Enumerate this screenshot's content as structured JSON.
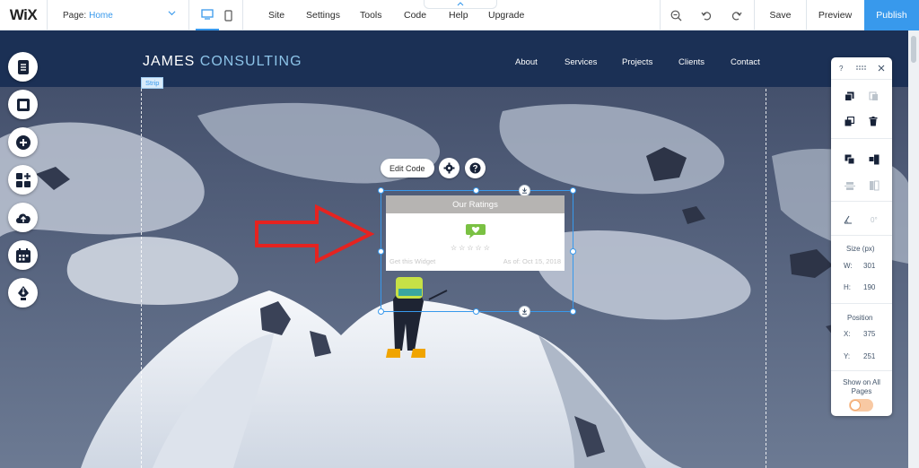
{
  "topbar": {
    "logo": "WiX",
    "page_label": "Page:",
    "page_value": "Home",
    "menu": [
      "Site",
      "Settings",
      "Tools",
      "Code",
      "Help",
      "Upgrade"
    ],
    "save": "Save",
    "preview": "Preview",
    "publish": "Publish"
  },
  "site": {
    "title_part1": "JAMES",
    "title_part2": "CONSULTING",
    "nav": [
      "About",
      "Services",
      "Projects",
      "Clients",
      "Contact"
    ],
    "strip_tag": "Strip"
  },
  "widget_toolbar": {
    "edit_code": "Edit Code"
  },
  "widget": {
    "title": "Our Ratings",
    "stars": "☆☆☆☆☆",
    "footer_left": "Get this Widget",
    "footer_right": "As of: Oct 15, 2018"
  },
  "panel": {
    "help": "?",
    "angle": "0°",
    "size_label": "Size (px)",
    "w_label": "W:",
    "w_value": "301",
    "h_label": "H:",
    "h_value": "190",
    "position_label": "Position",
    "x_label": "X:",
    "x_value": "375",
    "y_label": "Y:",
    "y_value": "251",
    "show_all_pages": "Show on All Pages",
    "show_all_pages_on": false
  },
  "colors": {
    "accent": "#3899ec",
    "header_bg": "#1b3055",
    "arrow": "#e52320",
    "widget_logo": "#7ac143"
  }
}
